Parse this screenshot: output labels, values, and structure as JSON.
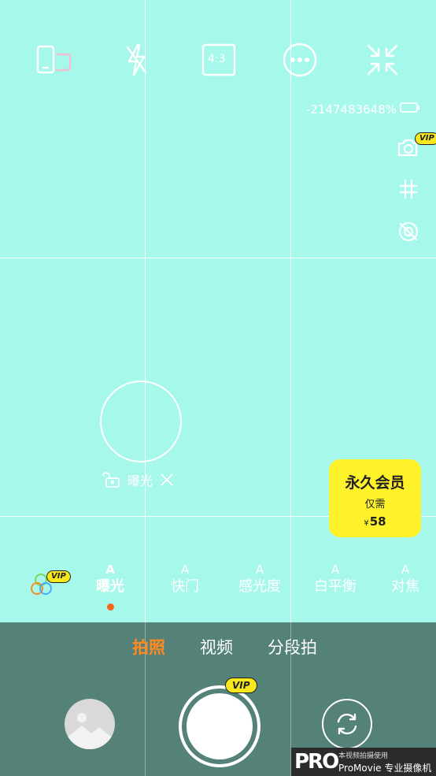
{
  "top_bar": {
    "icons": [
      "screen-rotate-icon",
      "flash-off-icon",
      "aspect-ratio-icon",
      "more-icon",
      "collapse-icon"
    ],
    "aspect_ratio": "4:3"
  },
  "status": {
    "battery_text": "-2147483648%"
  },
  "side_tools": {
    "icons": [
      "camera-settings-icon",
      "grid-icon",
      "stabilizer-off-icon"
    ],
    "vip_label": "VIP"
  },
  "exposure": {
    "label": "曝光"
  },
  "member_card": {
    "title": "永久会员",
    "subtitle": "仅需",
    "currency": "¥",
    "price": "58"
  },
  "params": {
    "filter_vip": "VIP",
    "items": [
      {
        "auto": "A",
        "label": "曝光"
      },
      {
        "auto": "A",
        "label": "快门"
      },
      {
        "auto": "A",
        "label": "感光度"
      },
      {
        "auto": "A",
        "label": "白平衡"
      },
      {
        "auto": "A",
        "label": "对焦"
      }
    ]
  },
  "modes": {
    "photo": "拍照",
    "video": "视频",
    "segment": "分段拍"
  },
  "shutter": {
    "vip_label": "VIP"
  },
  "watermark": {
    "logo": "PRO",
    "line1": "本视频拍摄使用",
    "line2": "ProMovie 专业摄像机"
  },
  "colors": {
    "background": "#a6f8eb",
    "panel": "#548278",
    "accent": "#ff8a1f",
    "vip": "#f7e71c"
  }
}
